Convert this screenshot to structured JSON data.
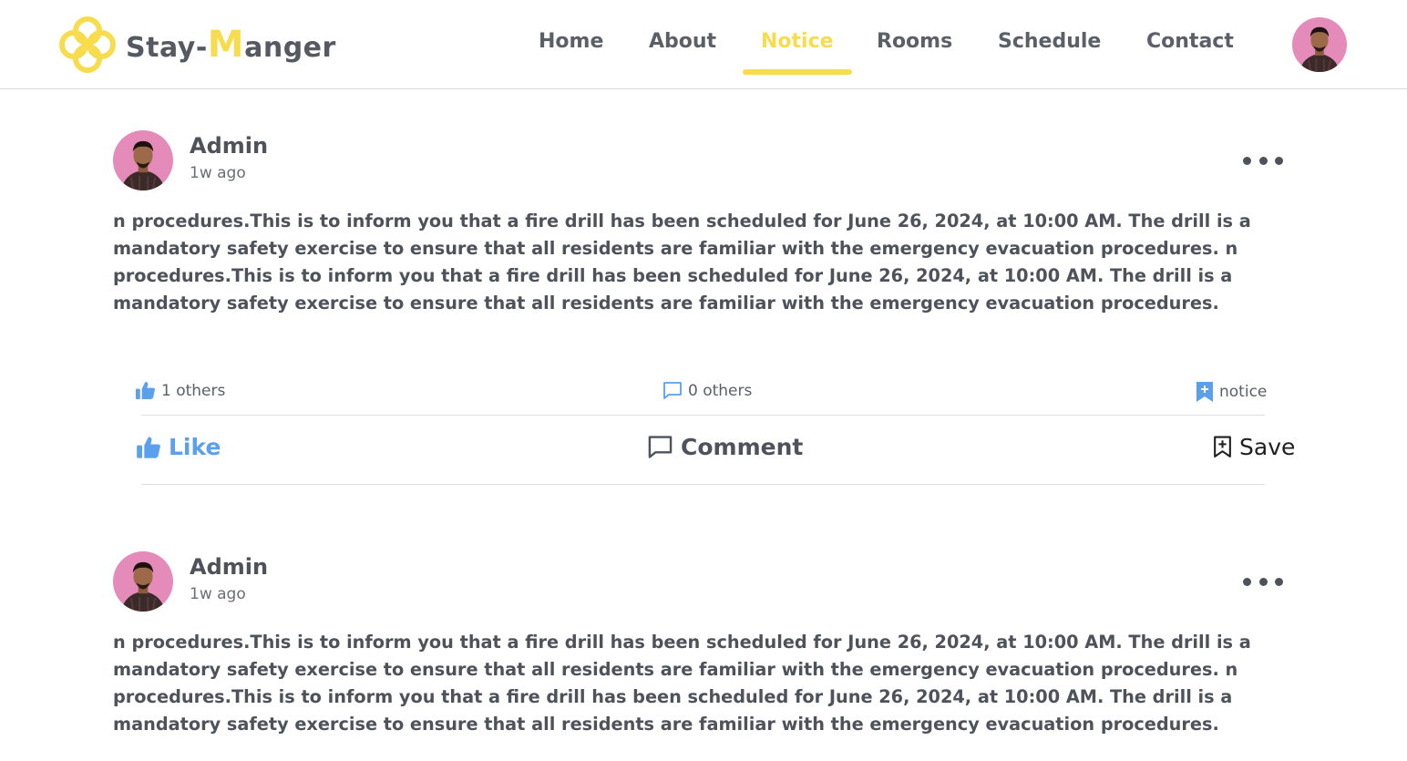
{
  "brand": {
    "prefix": "Stay-",
    "accent_letter": "M",
    "suffix": "anger"
  },
  "nav": {
    "items": [
      {
        "label": "Home"
      },
      {
        "label": "About"
      },
      {
        "label": "Notice"
      },
      {
        "label": "Rooms"
      },
      {
        "label": "Schedule"
      },
      {
        "label": "Contact"
      }
    ],
    "active_label": "Notice"
  },
  "colors": {
    "accent": "#f7dc4d",
    "like_blue": "#5aa0ec",
    "text": "#4e535b"
  },
  "posts": [
    {
      "author": "Admin",
      "time": "1w ago",
      "body": "n procedures.This is to inform you that a fire drill has been scheduled for June 26, 2024, at 10:00 AM. The drill is a mandatory safety exercise to ensure that all residents are familiar with the emergency evacuation procedures. n procedures.This is to inform you that a fire drill has been scheduled for June 26, 2024, at 10:00 AM. The drill is a mandatory safety exercise to ensure that all residents are familiar with the emergency evacuation procedures.",
      "likes_text": "1 others",
      "comments_text": "0 others",
      "tag_text": "notice",
      "actions": {
        "like": "Like",
        "comment": "Comment",
        "save": "Save"
      }
    },
    {
      "author": "Admin",
      "time": "1w ago",
      "body": "n procedures.This is to inform you that a fire drill has been scheduled for June 26, 2024, at 10:00 AM. The drill is a mandatory safety exercise to ensure that all residents are familiar with the emergency evacuation procedures. n procedures.This is to inform you that a fire drill has been scheduled for June 26, 2024, at 10:00 AM. The drill is a mandatory safety exercise to ensure that all residents are familiar with the emergency evacuation procedures."
    }
  ]
}
